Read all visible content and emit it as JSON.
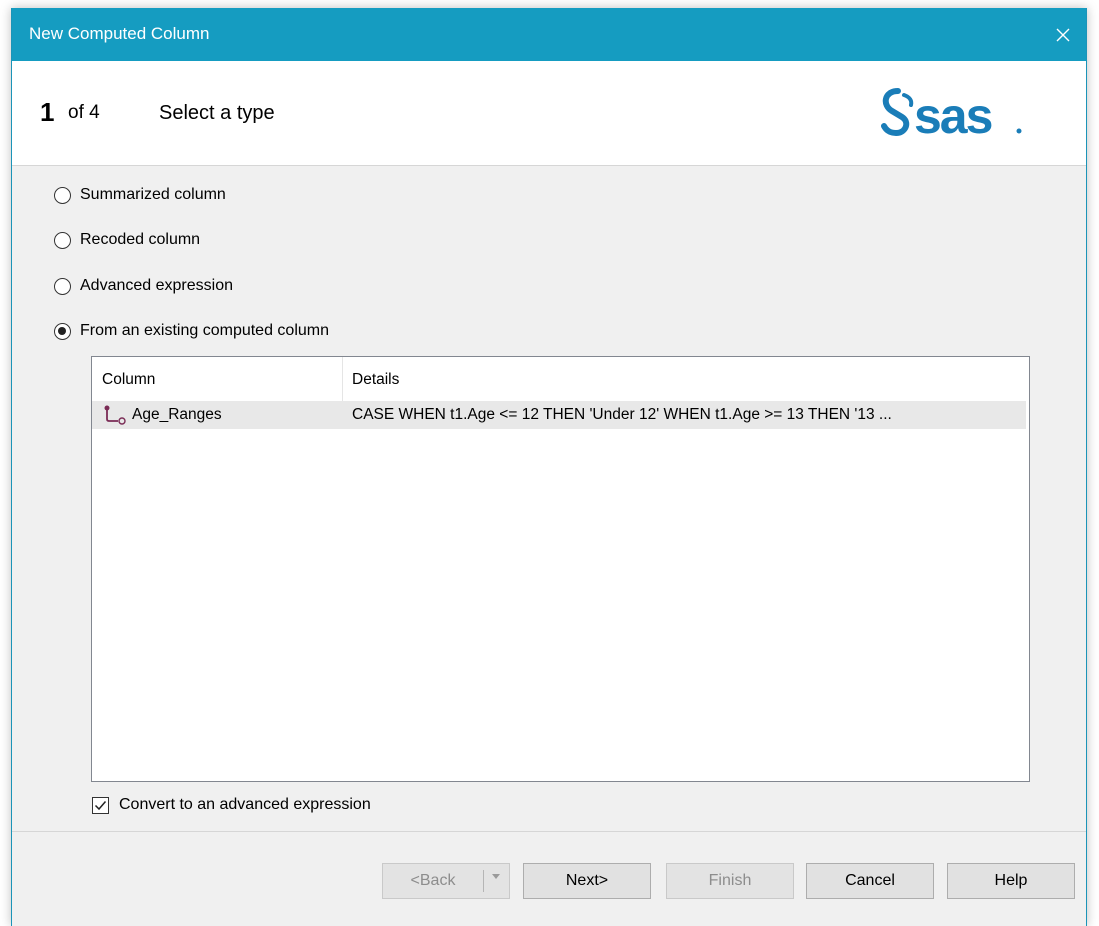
{
  "window": {
    "title": "New Computed Column",
    "close_glyph": "✕"
  },
  "header": {
    "step_number": "1",
    "step_of": "of 4",
    "step_title": "Select a type",
    "logo": "sas-logo"
  },
  "options": [
    {
      "label": "Summarized column",
      "checked": false
    },
    {
      "label": "Recoded column",
      "checked": false
    },
    {
      "label": "Advanced expression",
      "checked": false
    },
    {
      "label": "From an existing computed column",
      "checked": true
    }
  ],
  "list": {
    "columns": [
      "Column",
      "Details"
    ],
    "rows": [
      {
        "icon": "computed-column-icon",
        "column": "Age_Ranges",
        "details": "CASE WHEN t1.Age <= 12 THEN 'Under 12' WHEN t1.Age >= 13 THEN '13 ..."
      }
    ]
  },
  "convert_checkbox": {
    "label": "Convert to an advanced expression",
    "checked": true
  },
  "buttons": {
    "back": "<Back",
    "next": "Next>",
    "finish": "Finish",
    "cancel": "Cancel",
    "help": "Help"
  },
  "colors": {
    "title_bar": "#159cc1",
    "sas_blue": "#1a7db8"
  }
}
